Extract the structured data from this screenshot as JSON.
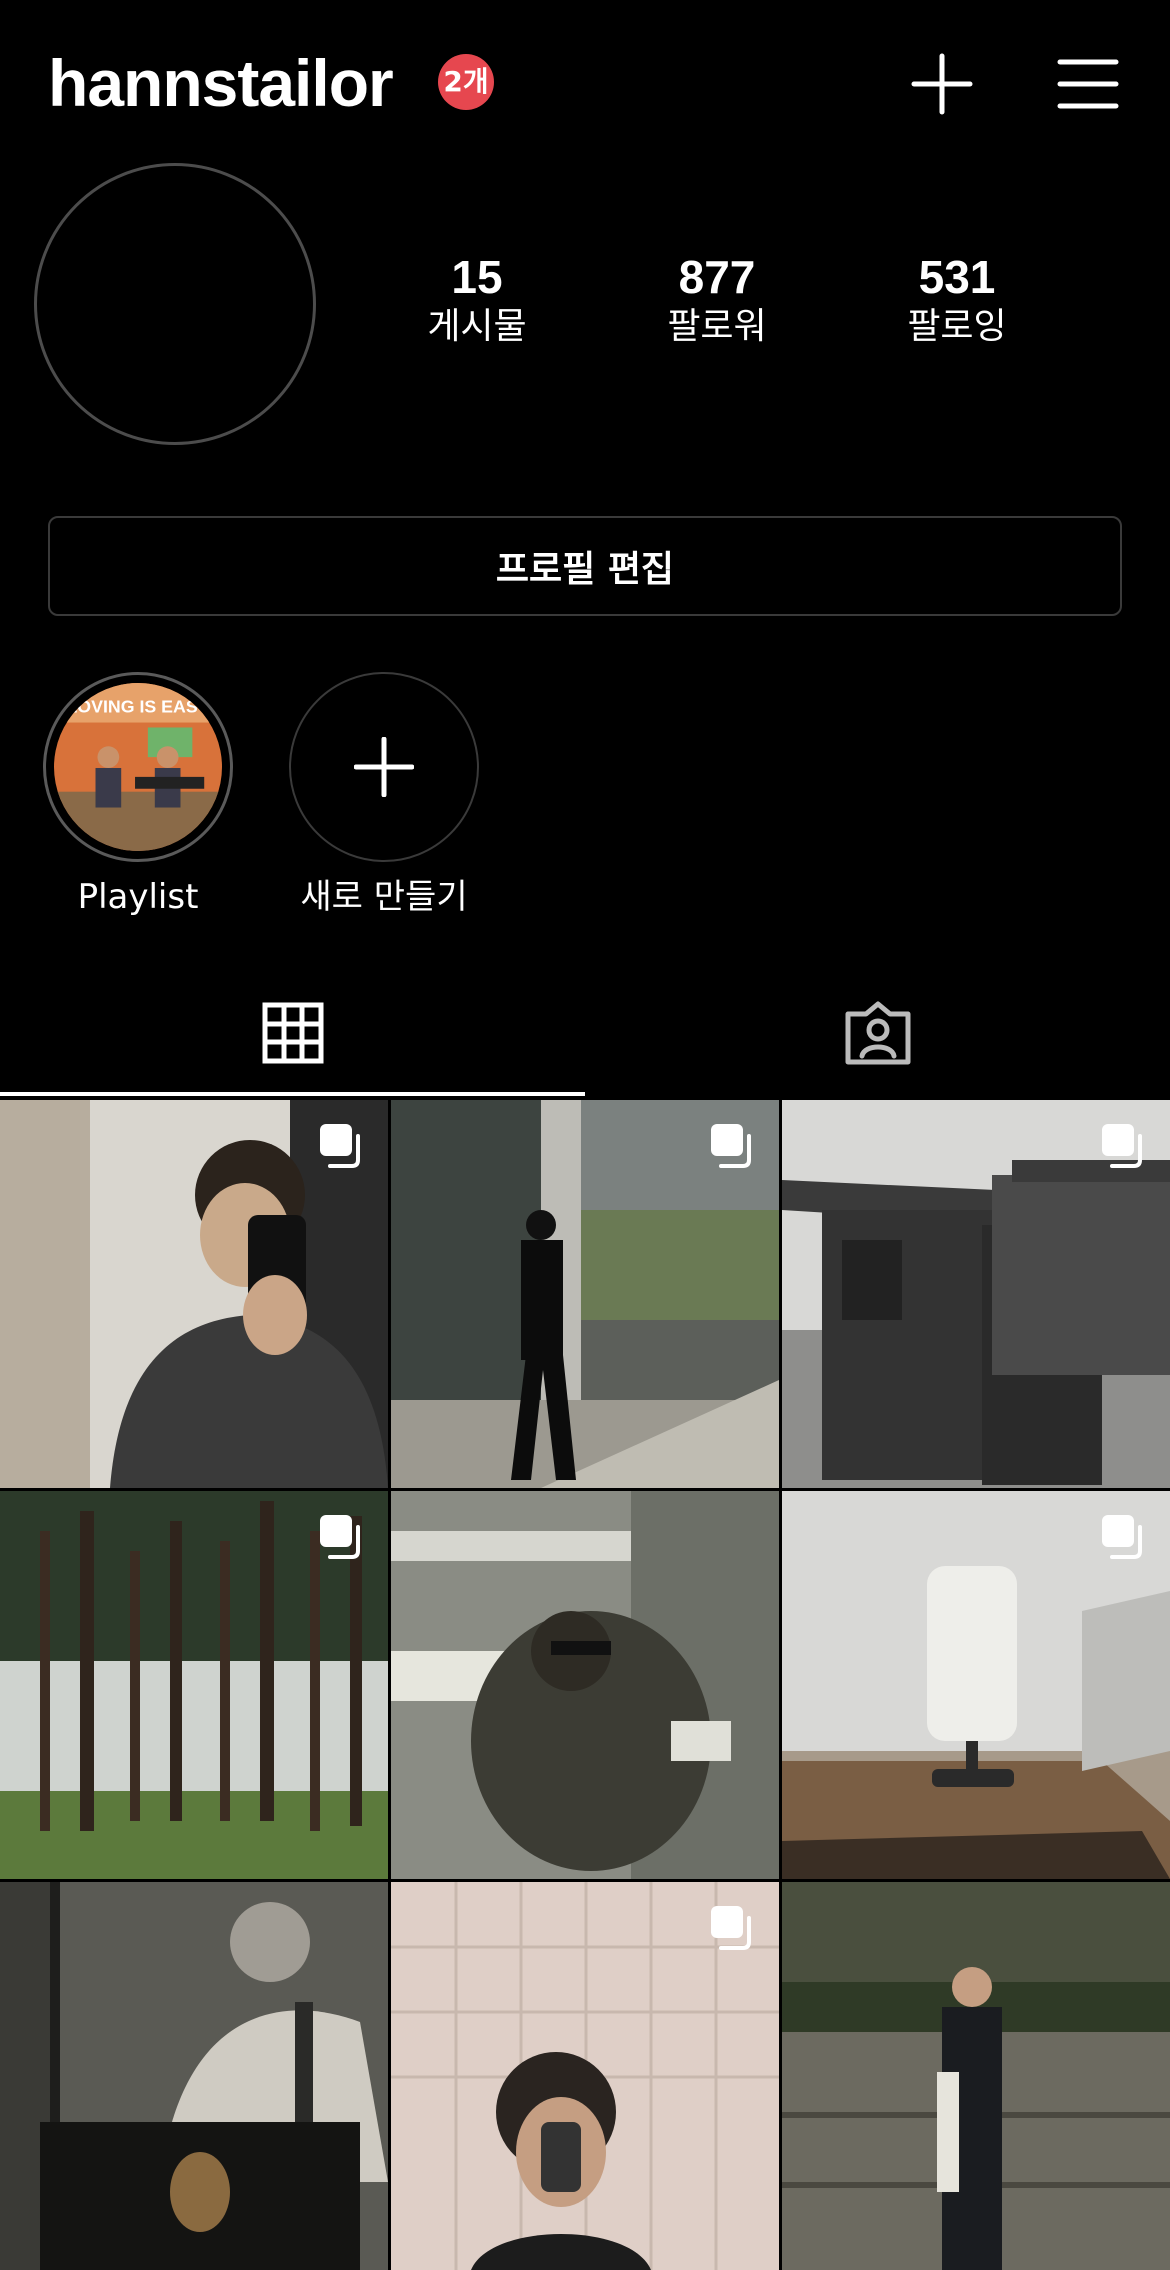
{
  "header": {
    "username": "hannstailor",
    "badge": "2개"
  },
  "stats": [
    {
      "value": "15",
      "label": "게시물"
    },
    {
      "value": "877",
      "label": "팔로워"
    },
    {
      "value": "531",
      "label": "팔로잉"
    }
  ],
  "edit_profile_label": "프로필 편집",
  "highlights": [
    {
      "label": "Playlist",
      "cover_text": "LOVING IS EASY"
    },
    {
      "label": "새로 만들기"
    }
  ],
  "tabs": [
    {
      "icon": "grid-icon",
      "active": true
    },
    {
      "icon": "tagged-person-icon",
      "active": false
    }
  ],
  "posts": [
    {
      "desc": "mirror selfie",
      "multi": true
    },
    {
      "desc": "man walking by cafe",
      "multi": true
    },
    {
      "desc": "dark wood table",
      "multi": true
    },
    {
      "desc": "pine forest",
      "multi": true
    },
    {
      "desc": "blurred reflection",
      "multi": false
    },
    {
      "desc": "white lamp",
      "multi": true
    },
    {
      "desc": "man with cigarette",
      "multi": false
    },
    {
      "desc": "tiled bathroom selfie",
      "multi": true
    },
    {
      "desc": "man by stone wall",
      "multi": false
    }
  ],
  "colors": {
    "background": "#000000",
    "badge": "#e6474f",
    "border": "#3a3a3a"
  }
}
